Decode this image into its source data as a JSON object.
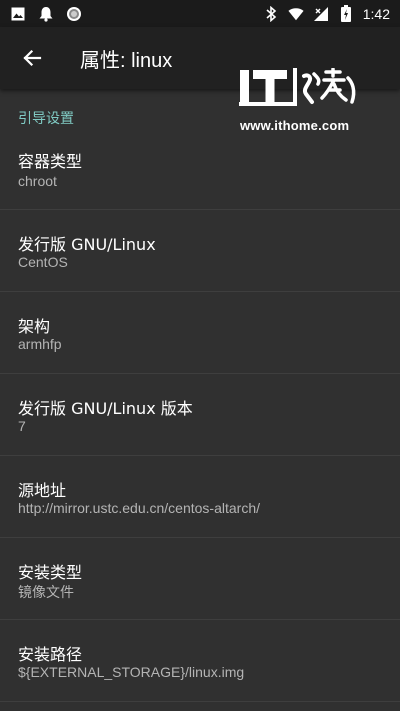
{
  "status_bar": {
    "time": "1:42",
    "left_icons": [
      "image-icon",
      "notification-bell-icon",
      "circle-icon"
    ],
    "right_icons": [
      "bluetooth-icon",
      "wifi-icon",
      "signal-icon",
      "battery-icon"
    ]
  },
  "toolbar": {
    "back_icon": "arrow-back-icon",
    "title": "属性: linux"
  },
  "watermark": {
    "logo_text": "IT之家",
    "url": "www.ithome.com"
  },
  "section": {
    "header": "引导设置"
  },
  "preferences": [
    {
      "title": "容器类型",
      "summary": "chroot"
    },
    {
      "title": "发行版 GNU/Linux",
      "summary": "CentOS"
    },
    {
      "title": "架构",
      "summary": "armhfp"
    },
    {
      "title": "发行版 GNU/Linux 版本",
      "summary": "7"
    },
    {
      "title": "源地址",
      "summary": "http://mirror.ustc.edu.cn/centos-altarch/"
    },
    {
      "title": "安装类型",
      "summary": "镜像文件"
    },
    {
      "title": "安装路径",
      "summary": "${EXTERNAL_STORAGE}/linux.img"
    }
  ],
  "colors": {
    "background": "#303030",
    "toolbar": "#212121",
    "status_bar": "#1b1b1b",
    "accent": "#80cbc4",
    "divider": "#3e3e3e"
  }
}
